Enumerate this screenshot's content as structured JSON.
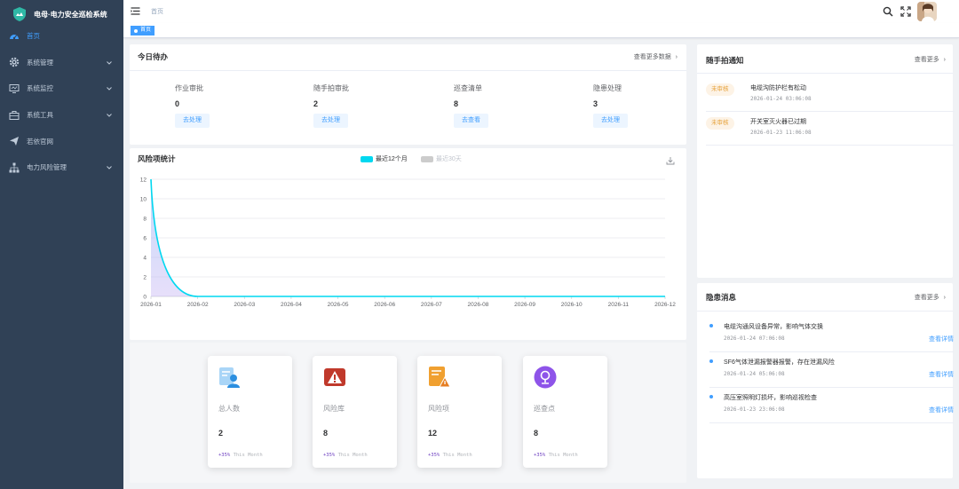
{
  "app": {
    "title": "电母·电力安全巡检系统"
  },
  "sidebar": {
    "items": [
      {
        "label": "首页",
        "icon": "dashboard-icon",
        "active": true
      },
      {
        "label": "系统管理",
        "icon": "gear-icon",
        "active": false
      },
      {
        "label": "系统监控",
        "icon": "monitor-icon",
        "active": false
      },
      {
        "label": "系统工具",
        "icon": "toolbox-icon",
        "active": false
      },
      {
        "label": "若依官网",
        "icon": "send-icon",
        "active": false
      },
      {
        "label": "电力风险管理",
        "icon": "tree-icon",
        "active": false
      }
    ]
  },
  "header": {
    "breadcrumb": "首页",
    "tag": "首页"
  },
  "todo": {
    "title": "今日待办",
    "more": "查看更多数据",
    "items": [
      {
        "label": "作业审批",
        "count": "0",
        "action": "去处理"
      },
      {
        "label": "随手拍审批",
        "count": "2",
        "action": "去处理"
      },
      {
        "label": "巡查清单",
        "count": "8",
        "action": "去查看"
      },
      {
        "label": "隐患处理",
        "count": "3",
        "action": "去处理"
      }
    ]
  },
  "risk_chart": {
    "title": "风险项统计",
    "legend_active": "最近12个月",
    "legend_inactive": "最近30天"
  },
  "chart_data": {
    "type": "area",
    "title": "风险项统计",
    "categories": [
      "2026-01",
      "2026-02",
      "2026-03",
      "2026-04",
      "2026-05",
      "2026-06",
      "2026-07",
      "2026-08",
      "2026-09",
      "2026-10",
      "2026-11",
      "2026-12"
    ],
    "series": [
      {
        "name": "最近12个月",
        "values": [
          12,
          0,
          0,
          0,
          0,
          0,
          0,
          0,
          0,
          0,
          0,
          0
        ],
        "color": "#00d8f0"
      }
    ],
    "yticks": [
      "0",
      "2",
      "4",
      "6",
      "8",
      "10",
      "12"
    ],
    "ylim": [
      0,
      12
    ],
    "grid": true,
    "legend": "top-center"
  },
  "stats": [
    {
      "label": "总人数",
      "value": "2",
      "pct": "+35%",
      "trend": "This Month",
      "icon": "user-card-icon"
    },
    {
      "label": "风险库",
      "value": "8",
      "pct": "+35%",
      "trend": "This Month",
      "icon": "warning-icon"
    },
    {
      "label": "风险项",
      "value": "12",
      "pct": "+35%",
      "trend": "This Month",
      "icon": "document-warning-icon"
    },
    {
      "label": "巡查点",
      "value": "8",
      "pct": "+35%",
      "trend": "This Month",
      "icon": "location-icon"
    }
  ],
  "snapshot": {
    "title": "随手拍通知",
    "more": "查看更多",
    "items": [
      {
        "badge": "未审核",
        "title": "电缆沟防护栏有松动",
        "time": "2026-01-24 03:06:08"
      },
      {
        "badge": "未审核",
        "title": "开关室灭火器已过期",
        "time": "2026-01-23 11:06:08"
      }
    ]
  },
  "hazard": {
    "title": "隐患消息",
    "more": "查看更多",
    "items": [
      {
        "title": "电缆沟通风设备异常，影响气体交换",
        "time": "2026-01-24 07:06:08",
        "link": "查看详情"
      },
      {
        "title": "SF6气体泄漏报警器报警，存在泄漏风险",
        "time": "2026-01-24 05:06:08",
        "link": "查看详情"
      },
      {
        "title": "高压室照明灯损坏，影响巡视检查",
        "time": "2026-01-23 23:06:08",
        "link": "查看详情"
      }
    ]
  },
  "colors": {
    "sidebar": "#304156",
    "accent": "#409eff",
    "chart_line": "#00d8f0",
    "badge_bg": "#fdf3e6",
    "badge_text": "#e6a23c"
  }
}
